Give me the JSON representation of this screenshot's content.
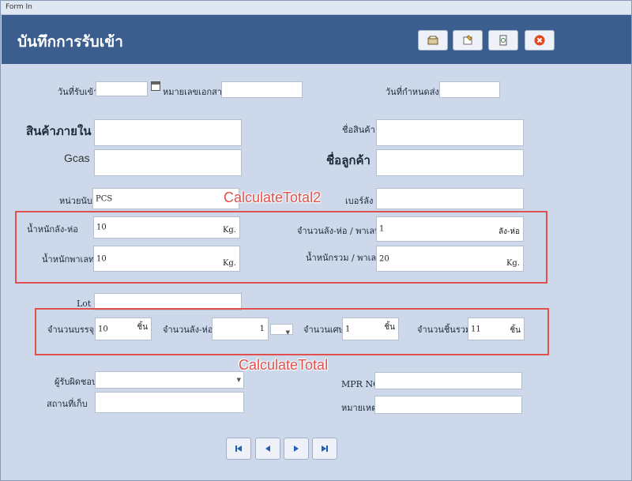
{
  "window": {
    "title": "Form In"
  },
  "header": {
    "title": "บันทึกการรับเข้า"
  },
  "toolbar": {
    "icons": [
      "new-icon",
      "edit-icon",
      "print-icon",
      "close-icon"
    ]
  },
  "form": {
    "receive_date_label": "วันที่รับเข้า",
    "doc_no_label": "หมายเลขเอกสาร",
    "due_date_label": "วันที่กำหนดส่ง",
    "local_product_label": "สินค้าภายใน",
    "product_name_label": "ชื่อสินค้า",
    "gcas_label": "Gcas",
    "customer_name_label": "ชื่อลูกค้า",
    "unit_label": "หน่วยนับ",
    "unit_value": "PCS",
    "box_no_label": "เบอร์ลัง",
    "box_weight_label": "น้ำหนักลัง-ห่อ",
    "box_weight_value": "10",
    "box_weight_unit": "Kg.",
    "boxes_per_pallet_label": "จำนวนลัง-ห่อ / พาเลท",
    "boxes_per_pallet_value": "1",
    "boxes_per_pallet_unit": "ลัง-ห่อ",
    "pallet_weight_label": "น้ำหนักพาเลท",
    "pallet_weight_value": "10",
    "pallet_weight_unit": "Kg.",
    "total_weight_label": "น้ำหนักรวม / พาเลท",
    "total_weight_value": "20",
    "total_weight_unit": "Kg.",
    "lot_label": "Lot",
    "pack_qty_label": "จำนวนบรรจุ",
    "pack_qty_value": "10",
    "pack_qty_unit": "ชิ้น",
    "box_qty_label": "จำนวนลัง-ห่อ",
    "box_qty_value": "1",
    "remainder_label": "จำนวนเศษ",
    "remainder_value": "1",
    "remainder_unit": "ชิ้น",
    "total_pieces_label": "จำนวนชิ้นรวม",
    "total_pieces_value": "11",
    "total_pieces_unit": "ชิ้น",
    "responsible_label": "ผู้รับผิดชอบ",
    "mpr_label": "MPR NO",
    "location_label": "สถานที่เก็บ",
    "remark_label": "หมายเหตุ"
  },
  "annotations": {
    "calc_total2": "CalculateTotal2",
    "calc_total": "CalculateTotal"
  },
  "nav": {
    "icons": [
      "first-icon",
      "prev-icon",
      "next-icon",
      "last-icon"
    ]
  },
  "colors": {
    "header": "#3b5e8f",
    "background": "#cdd9ea",
    "annotation": "#e0504c"
  }
}
